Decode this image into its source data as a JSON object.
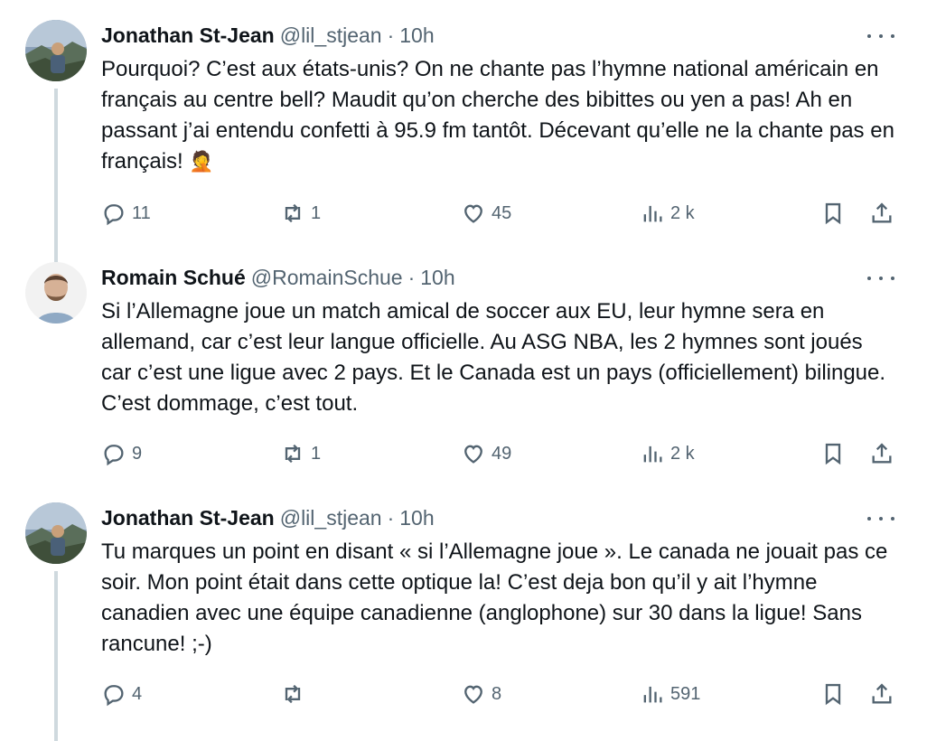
{
  "tweets": [
    {
      "name": "Jonathan St-Jean",
      "handle": "@lil_stjean",
      "time": "10h",
      "text": "Pourquoi? C’est aux états-unis? On ne chante pas l’hymne national américain en français au centre bell? Maudit qu’on cherche des bibittes ou yen a pas! Ah en passant j’ai entendu confetti à 95.9 fm tantôt. Décevant qu’elle ne la chante pas en français!",
      "emoji": "🤦",
      "replies": "11",
      "retweets": "1",
      "likes": "45",
      "views": "2 k"
    },
    {
      "name": "Romain Schué",
      "handle": "@RomainSchue",
      "time": "10h",
      "text": "Si l’Allemagne joue un match amical de soccer aux EU, leur hymne sera en allemand, car c’est leur langue officielle. Au ASG NBA, les 2 hymnes sont joués car c’est une ligue avec 2 pays. Et le Canada est un pays (officiellement) bilingue. C’est dommage, c’est tout.",
      "emoji": "",
      "replies": "9",
      "retweets": "1",
      "likes": "49",
      "views": "2 k"
    },
    {
      "name": "Jonathan St-Jean",
      "handle": "@lil_stjean",
      "time": "10h",
      "text": "Tu marques un point en disant « si l’Allemagne joue ». Le canada ne jouait pas ce soir. Mon point était dans cette optique la! C’est deja bon qu’il y ait l’hymne canadien avec une équipe canadienne (anglophone) sur 30 dans la ligue! Sans rancune! ;-)",
      "emoji": "",
      "replies": "4",
      "retweets": "",
      "likes": "8",
      "views": "591"
    }
  ],
  "separator": "·"
}
